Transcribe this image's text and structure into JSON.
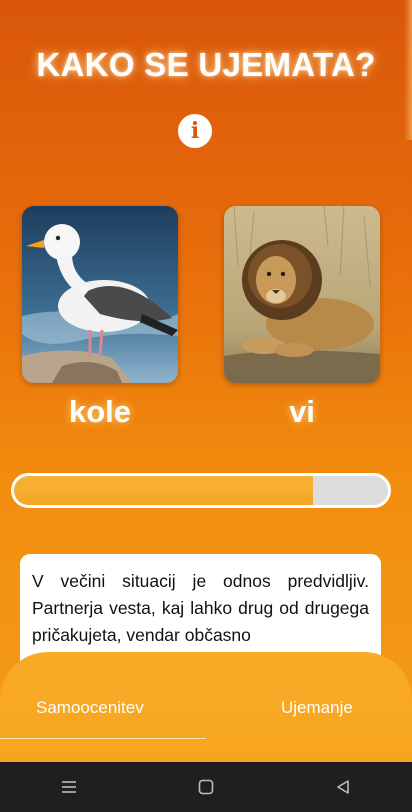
{
  "screen": {
    "title": "KAKO SE UJEMATA?",
    "info_icon": "info-icon"
  },
  "pair": {
    "left": {
      "label": "kole",
      "image": "seagull"
    },
    "right": {
      "label": "vi",
      "image": "lion"
    }
  },
  "compatibility": {
    "progress": 0.8
  },
  "description": {
    "text": "V večini situacij je odnos predvidljiv. Partnerja vesta, kaj lahko drug od drugega pričakujeta, vendar občasno"
  },
  "tabs": [
    {
      "label": "Samoocenitev",
      "active": true
    },
    {
      "label": "Ujemanje",
      "active": false
    }
  ],
  "system_nav": {
    "icons": [
      "menu-icon",
      "home-square-icon",
      "back-triangle-icon"
    ]
  },
  "colors": {
    "accent": "#f5a623",
    "background_top": "#d9560a",
    "background_bottom": "#f4a11a"
  }
}
